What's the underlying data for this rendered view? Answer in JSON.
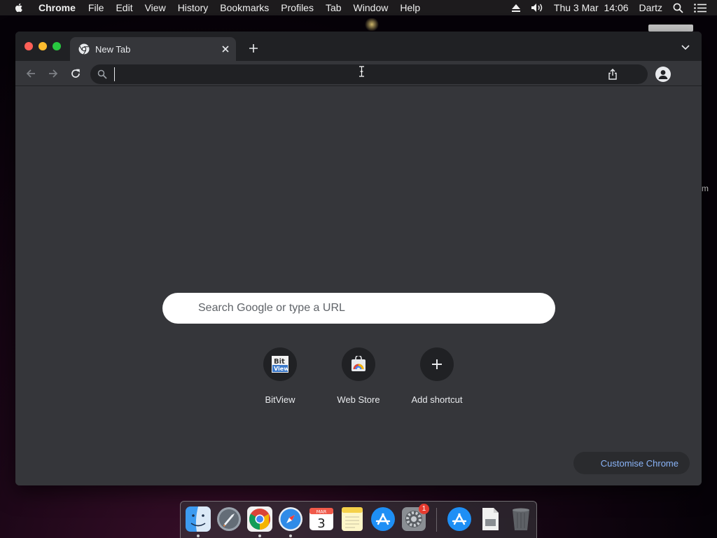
{
  "menubar": {
    "app_name": "Chrome",
    "items": [
      "File",
      "Edit",
      "View",
      "History",
      "Bookmarks",
      "Profiles",
      "Tab",
      "Window",
      "Help"
    ],
    "clock": "Thu 3 Mar  14:06",
    "user": "Dartz"
  },
  "browser": {
    "tab_title": "New Tab",
    "address_value": "",
    "address_placeholder": ""
  },
  "newtab": {
    "search_placeholder": "Search Google or type a URL",
    "shortcuts": [
      {
        "label": "BitView",
        "icon": "bitview-icon"
      },
      {
        "label": "Web Store",
        "icon": "web-store-icon"
      },
      {
        "label": "Add shortcut",
        "icon": "plus-icon"
      }
    ],
    "customise_label": "Customise Chrome"
  },
  "desktop": {
    "partial_text": "m"
  },
  "dock": {
    "apps": [
      "Finder",
      "Launchpad",
      "Google Chrome",
      "Safari",
      "Calendar",
      "Notes",
      "App Store",
      "System Preferences",
      "App Store",
      "Document",
      "Trash"
    ],
    "calendar_month": "MAR",
    "calendar_day": "3",
    "system_prefs_badge": "1"
  },
  "colors": {
    "tabstrip": "#202124",
    "toolbar": "#35363a",
    "link_accent": "#8ab4f8",
    "close": "#fe5f57",
    "minimize": "#febc2e",
    "maximize": "#28c840"
  }
}
